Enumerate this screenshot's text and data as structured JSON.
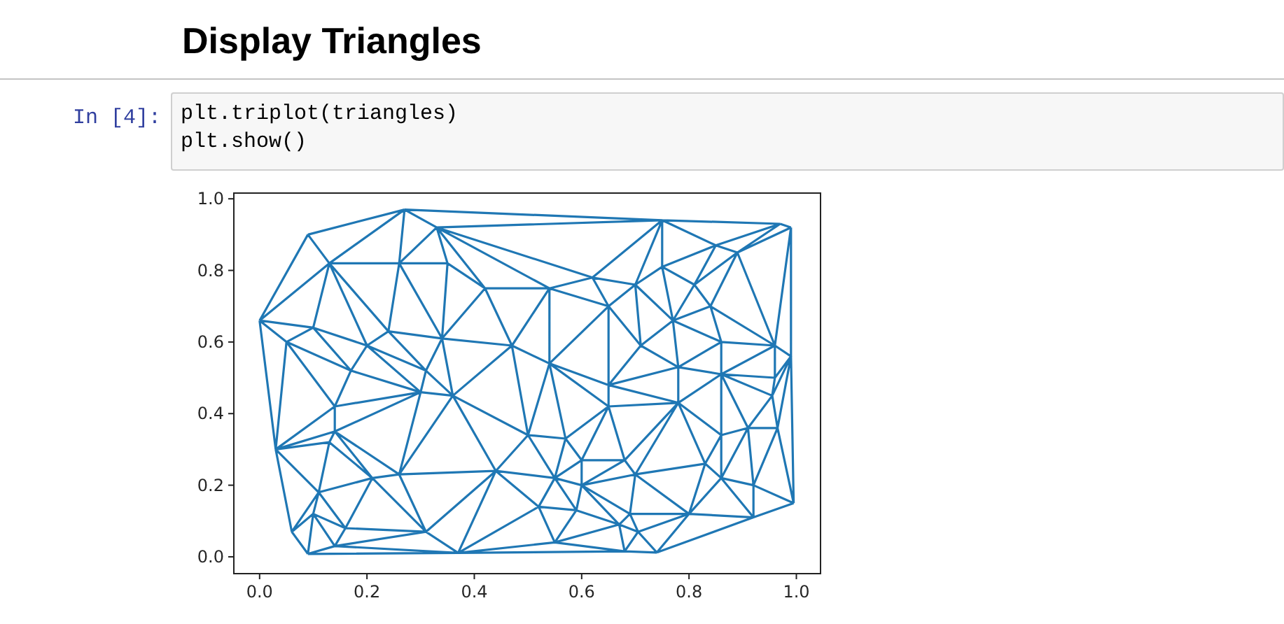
{
  "heading": "Display Triangles",
  "cell": {
    "prompt": "In [4]:",
    "code": [
      "plt.triplot(triangles)",
      "plt.show()"
    ],
    "output": {
      "chart_data": {
        "type": "line",
        "xlim": [
          -0.048,
          1.045
        ],
        "ylim": [
          -0.047,
          1.016
        ],
        "xticks": [
          {
            "value": 0,
            "label": "0.0"
          },
          {
            "value": 0.2,
            "label": "0.2"
          },
          {
            "value": 0.4,
            "label": "0.4"
          },
          {
            "value": 0.6,
            "label": "0.6"
          },
          {
            "value": 0.8,
            "label": "0.8"
          },
          {
            "value": 1,
            "label": "1.0"
          }
        ],
        "yticks": [
          {
            "value": 0,
            "label": "0.0"
          },
          {
            "value": 0.2,
            "label": "0.2"
          },
          {
            "value": 0.4,
            "label": "0.4"
          },
          {
            "value": 0.6,
            "label": "0.6"
          },
          {
            "value": 0.8,
            "label": "0.8"
          },
          {
            "value": 1,
            "label": "1.0"
          }
        ]
      }
    }
  }
}
